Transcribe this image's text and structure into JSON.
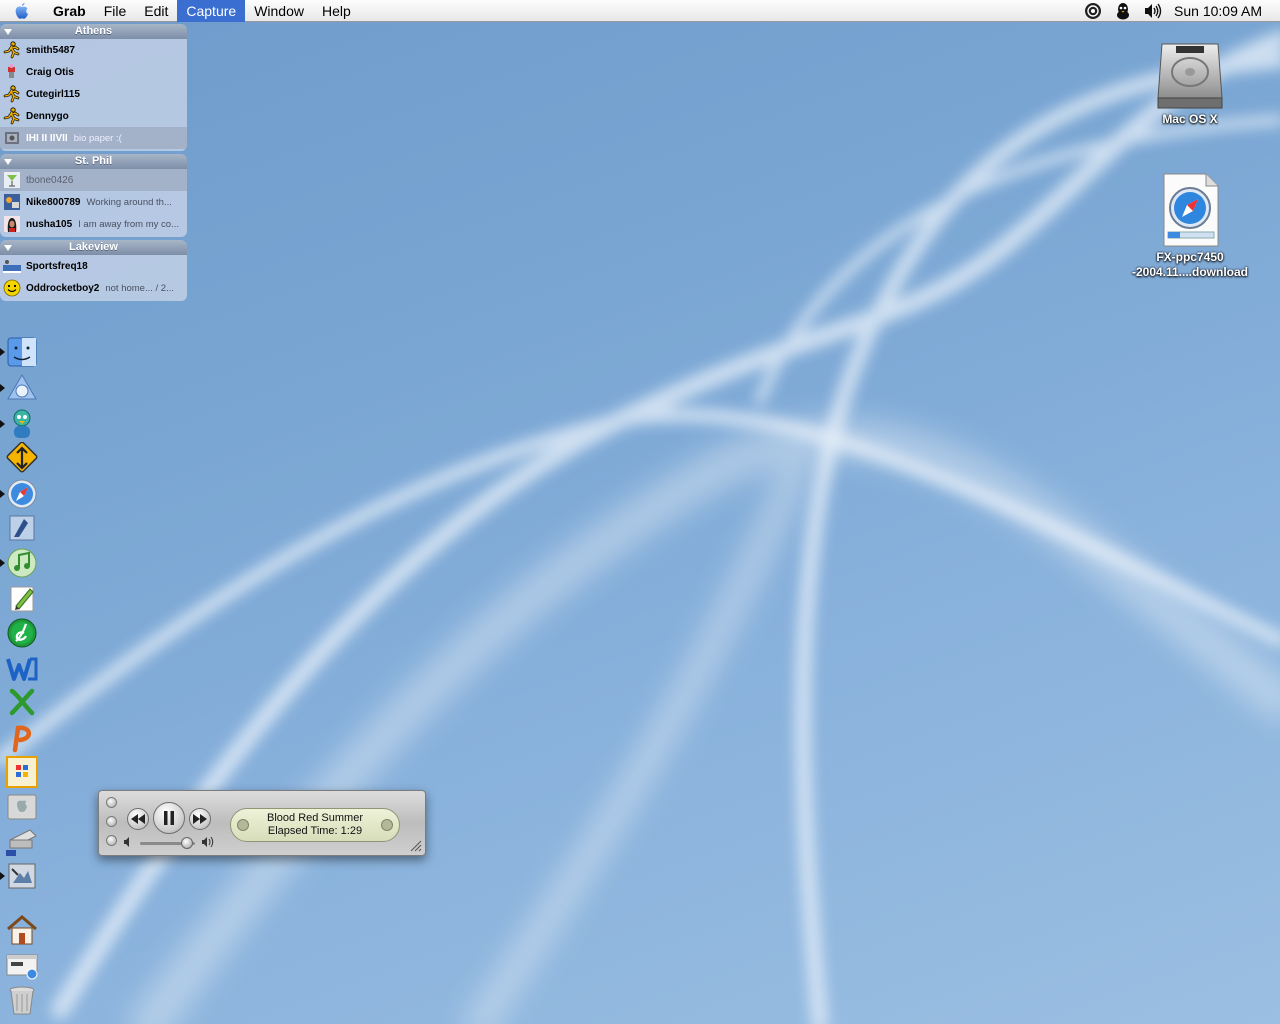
{
  "menubar": {
    "apple_icon": "apple-icon",
    "app_name": "Grab",
    "menus": [
      "File",
      "Edit",
      "Capture",
      "Window",
      "Help"
    ],
    "active_menu": "Capture",
    "extras": [
      "airport-icon",
      "aim-icon",
      "volume-icon"
    ],
    "clock": "Sun 10:09 AM"
  },
  "buddylist": {
    "groups": [
      {
        "name": "Athens",
        "buddies": [
          {
            "name": "smith5487",
            "status": "",
            "icon": "aim-running-man-icon"
          },
          {
            "name": "Craig Otis",
            "status": "",
            "icon": "buddy-pic-icon"
          },
          {
            "name": "Cutegirl115",
            "status": "",
            "icon": "aim-running-man-icon"
          },
          {
            "name": "Dennygo",
            "status": "",
            "icon": "aim-running-man-icon"
          },
          {
            "name": "IHI II IIVII",
            "status": "bio paper :(",
            "icon": "buddy-pic-icon"
          }
        ]
      },
      {
        "name": "St. Phil",
        "buddies": [
          {
            "name": "tbone0426",
            "status": "",
            "icon": "martini-icon"
          },
          {
            "name": "Nike800789",
            "status": "Working around th...",
            "icon": "buddy-pic-icon"
          },
          {
            "name": "nusha105",
            "status": "I am away from my co...",
            "icon": "buddy-pic-icon"
          }
        ]
      },
      {
        "name": "Lakeview",
        "buddies": [
          {
            "name": "Sportsfreq18",
            "status": "",
            "icon": "buddy-pic-icon"
          },
          {
            "name": "Oddrocketboy2",
            "status": "not home... / 2...",
            "icon": "smiley-icon"
          }
        ]
      }
    ]
  },
  "dock": {
    "items": [
      {
        "name": "finder-icon",
        "running": true
      },
      {
        "name": "ichat-icon",
        "running": true
      },
      {
        "name": "adium-icon",
        "running": true
      },
      {
        "name": "transmit-icon",
        "running": false
      },
      {
        "name": "safari-icon",
        "running": true
      },
      {
        "name": "mail-icon",
        "running": false
      },
      {
        "name": "itunes-icon",
        "running": true
      },
      {
        "name": "pencil-app-icon",
        "running": false
      },
      {
        "name": "dreamweaver-icon",
        "running": false
      },
      {
        "name": "word-icon",
        "running": false
      },
      {
        "name": "excel-icon",
        "running": false
      },
      {
        "name": "powerpoint-icon",
        "running": false
      },
      {
        "name": "office-setup-icon",
        "running": false
      },
      {
        "name": "system-preferences-icon",
        "running": false
      },
      {
        "name": "printer-icon",
        "running": false
      },
      {
        "name": "grab-icon",
        "running": true
      },
      {
        "name": "home-folder-icon",
        "running": false
      },
      {
        "name": "minimized-window-icon",
        "running": false
      },
      {
        "name": "trash-icon",
        "running": false
      }
    ]
  },
  "desktop": {
    "icons": [
      {
        "label_lines": [
          "Mac OS X"
        ],
        "icon": "hard-drive-icon"
      },
      {
        "label_lines": [
          "FX-ppc7450",
          "-2004.11....download"
        ],
        "icon": "safari-download-icon"
      }
    ]
  },
  "player": {
    "track": "Blood Red Summer",
    "elapsed": "Elapsed Time: 1:29",
    "volume_level": 0.85
  },
  "colors": {
    "menu_highlight": "#3a6fd1",
    "desktop": "#7aa6d3"
  }
}
